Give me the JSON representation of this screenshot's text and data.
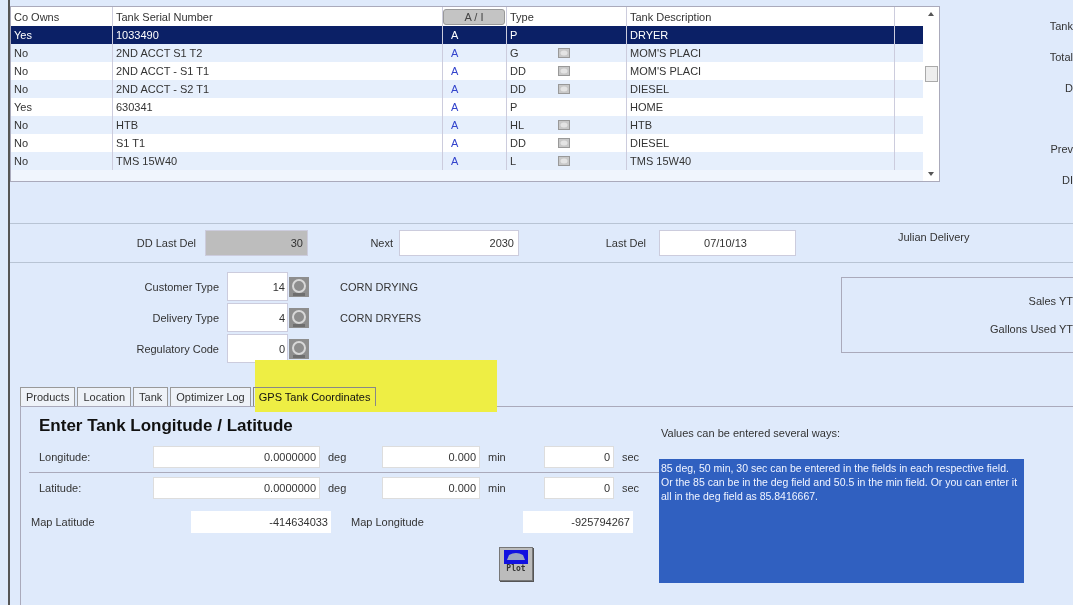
{
  "table": {
    "columns": [
      "Co Owns",
      "Tank Serial Number",
      "A / I",
      "Type",
      "Tank Description"
    ],
    "rows": [
      {
        "co_owns": "Yes",
        "serial": "1033490",
        "ai": "A",
        "type": "P",
        "note": false,
        "description": "DRYER",
        "selected": true
      },
      {
        "co_owns": "No",
        "serial": "2ND ACCT  S1 T2",
        "ai": "A",
        "type": "G",
        "note": true,
        "description": "MOM'S PLACI",
        "selected": false
      },
      {
        "co_owns": "No",
        "serial": "2ND ACCT - S1 T1",
        "ai": "A",
        "type": "DD",
        "note": true,
        "description": "MOM'S PLACI",
        "selected": false
      },
      {
        "co_owns": "No",
        "serial": "2ND ACCT - S2 T1",
        "ai": "A",
        "type": "DD",
        "note": true,
        "description": "DIESEL",
        "selected": false
      },
      {
        "co_owns": "Yes",
        "serial": "630341",
        "ai": "A",
        "type": "P",
        "note": false,
        "description": "HOME",
        "selected": false
      },
      {
        "co_owns": "No",
        "serial": "HTB",
        "ai": "A",
        "type": "HL",
        "note": true,
        "description": "HTB",
        "selected": false
      },
      {
        "co_owns": "No",
        "serial": "S1 T1",
        "ai": "A",
        "type": "DD",
        "note": true,
        "description": "DIESEL",
        "selected": false
      },
      {
        "co_owns": "No",
        "serial": "TMS 15W40",
        "ai": "A",
        "type": "L",
        "note": true,
        "description": "TMS 15W40",
        "selected": false
      }
    ]
  },
  "side_labels": [
    "Tank",
    "Total",
    "D",
    "Prev",
    "DI"
  ],
  "delivery": {
    "dd_last_del_label": "DD Last Del",
    "dd_last_del": "30",
    "next_label": "Next",
    "next": "2030",
    "last_del_label": "Last  Del",
    "last_del": "07/10/13",
    "julian_label": "Julian Delivery"
  },
  "codes": [
    {
      "label": "Customer Type",
      "value": "14",
      "description": "CORN DRYING"
    },
    {
      "label": "Delivery Type",
      "value": "4",
      "description": "CORN DRYERS"
    },
    {
      "label": "Regulatory Code",
      "value": "0"
    }
  ],
  "ytd_labels": [
    "Sales YT",
    "Gallons Used YT"
  ],
  "tabs": [
    {
      "label": "Products",
      "selected": false
    },
    {
      "label": "Location",
      "selected": false
    },
    {
      "label": "Tank",
      "selected": false
    },
    {
      "label": "Optimizer Log",
      "selected": false
    },
    {
      "label": "GPS Tank Coordinates",
      "selected": true
    }
  ],
  "gps": {
    "title": "Enter Tank Longitude / Latitude",
    "coords": [
      {
        "label": "Longitude:",
        "deg": "0.0000000",
        "deg_unit": "deg",
        "min": "0.000",
        "min_unit": "min",
        "sec": "0",
        "sec_unit": "sec"
      },
      {
        "label": "Latitude:",
        "deg": "0.0000000",
        "deg_unit": "deg",
        "min": "0.000",
        "min_unit": "min",
        "sec": "0",
        "sec_unit": "sec"
      }
    ],
    "map_latitude_label": "Map Latitude",
    "map_latitude": "-414634033",
    "map_longitude_label": "Map Longitude",
    "map_longitude": "-925794267",
    "plot_label": "Plot",
    "help_title": "Values can be entered several ways:",
    "help_text": "85 deg, 50 min, 30 sec  can be entered in the fields in each respective field.  Or the 85 can be in the deg field and 50.5 in the min field.  Or you can enter it all in the deg field as 85.8416667."
  }
}
